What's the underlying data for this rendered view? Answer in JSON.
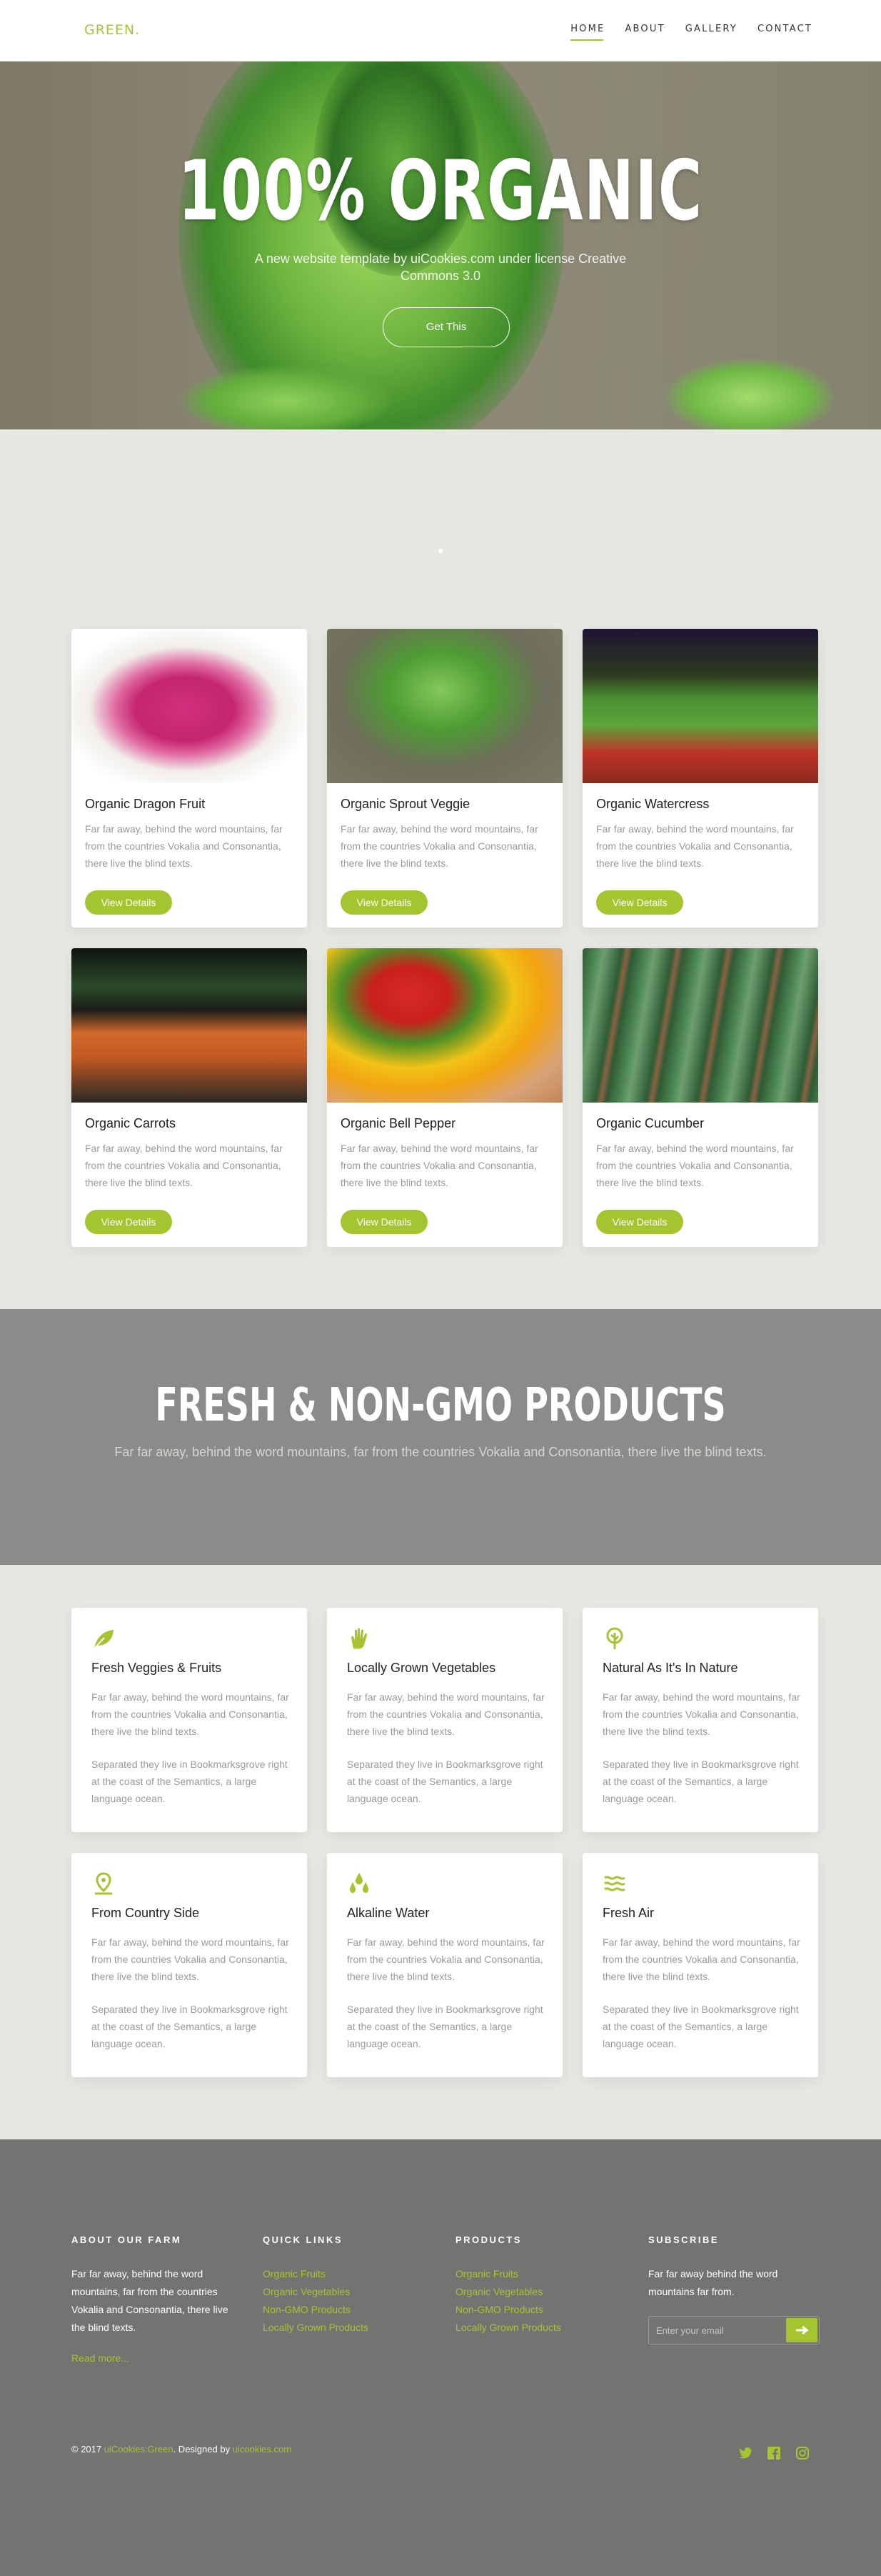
{
  "nav": {
    "logo": "GREEN.",
    "items": [
      {
        "label": "HOME",
        "active": true
      },
      {
        "label": "ABOUT"
      },
      {
        "label": "GALLERY"
      },
      {
        "label": "CONTACT"
      }
    ]
  },
  "hero": {
    "title": "100% ORGANIC",
    "subtitle": "A new website template by uiCookies.com under license Creative Commons 3.0",
    "button": "Get This"
  },
  "products": [
    {
      "title": "Organic Dragon Fruit",
      "text": "Far far away, behind the word mountains, far from the countries Vokalia and Consonantia, there live the blind texts.",
      "button": "View Details"
    },
    {
      "title": "Organic Sprout Veggie",
      "text": "Far far away, behind the word mountains, far from the countries Vokalia and Consonantia, there live the blind texts.",
      "button": "View Details"
    },
    {
      "title": "Organic Watercress",
      "text": "Far far away, behind the word mountains, far from the countries Vokalia and Consonantia, there live the blind texts.",
      "button": "View Details"
    },
    {
      "title": "Organic Carrots",
      "text": "Far far away, behind the word mountains, far from the countries Vokalia and Consonantia, there live the blind texts.",
      "button": "View Details"
    },
    {
      "title": "Organic Bell Pepper",
      "text": "Far far away, behind the word mountains, far from the countries Vokalia and Consonantia, there live the blind texts.",
      "button": "View Details"
    },
    {
      "title": "Organic Cucumber",
      "text": "Far far away, behind the word mountains, far from the countries Vokalia and Consonantia, there live the blind texts.",
      "button": "View Details"
    }
  ],
  "band": {
    "title": "FRESH & NON-GMO PRODUCTS",
    "subtitle": "Far far away, behind the word mountains, far from the countries Vokalia and Consonantia, there live the blind texts."
  },
  "features": [
    {
      "icon": "leaf-icon",
      "title": "Fresh Veggies & Fruits",
      "text": "Far far away, behind the word mountains, far from the countries Vokalia and Consonantia, there live the blind texts.",
      "text2": "Separated they live in Bookmarksgrove right at the coast of the Semantics, a large language ocean."
    },
    {
      "icon": "hand-icon",
      "title": "Locally Grown Vegetables",
      "text": "Far far away, behind the word mountains, far from the countries Vokalia and Consonantia, there live the blind texts.",
      "text2": "Separated they live in Bookmarksgrove right at the coast of the Semantics, a large language ocean."
    },
    {
      "icon": "tree-icon",
      "title": "Natural As It's In Nature",
      "text": "Far far away, behind the word mountains, far from the countries Vokalia and Consonantia, there live the blind texts.",
      "text2": "Separated they live in Bookmarksgrove right at the coast of the Semantics, a large language ocean."
    },
    {
      "icon": "location-pin-icon",
      "title": "From Country Side",
      "text": "Far far away, behind the word mountains, far from the countries Vokalia and Consonantia, there live the blind texts.",
      "text2": "Separated they live in Bookmarksgrove right at the coast of the Semantics, a large language ocean."
    },
    {
      "icon": "water-drops-icon",
      "title": "Alkaline Water",
      "text": "Far far away, behind the word mountains, far from the countries Vokalia and Consonantia, there live the blind texts.",
      "text2": "Separated they live in Bookmarksgrove right at the coast of the Semantics, a large language ocean."
    },
    {
      "icon": "wind-icon",
      "title": "Fresh Air",
      "text": "Far far away, behind the word mountains, far from the countries Vokalia and Consonantia, there live the blind texts.",
      "text2": "Separated they live in Bookmarksgrove right at the coast of the Semantics, a large language ocean."
    }
  ],
  "footer": {
    "about": {
      "heading": "ABOUT OUR FARM",
      "text": "Far far away, behind the word mountains, far from the countries Vokalia and Consonantia, there live the blind texts.",
      "read_more": "Read more..."
    },
    "quick_links": {
      "heading": "QUICK LINKS",
      "links": [
        "Organic Fruits",
        "Organic Vegetables",
        "Non-GMO Products",
        "Locally Grown Products"
      ]
    },
    "products": {
      "heading": "PRODUCTS",
      "links": [
        "Organic Fruits",
        "Organic Vegetables",
        "Non-GMO Products",
        "Locally Grown Products"
      ]
    },
    "subscribe": {
      "heading": "SUBSCRIBE",
      "text": "Far far away behind the word mountains far from.",
      "placeholder": "Enter your email"
    },
    "copyright": {
      "prefix": "© 2017",
      "brand": "uiCookies:Green",
      "middle": ". Designed by",
      "designer": "uicookies.com"
    }
  },
  "colors": {
    "accent": "#a5c530",
    "band": "#8b8b89",
    "footer": "#737371",
    "page_bg": "#e8e8e3"
  }
}
